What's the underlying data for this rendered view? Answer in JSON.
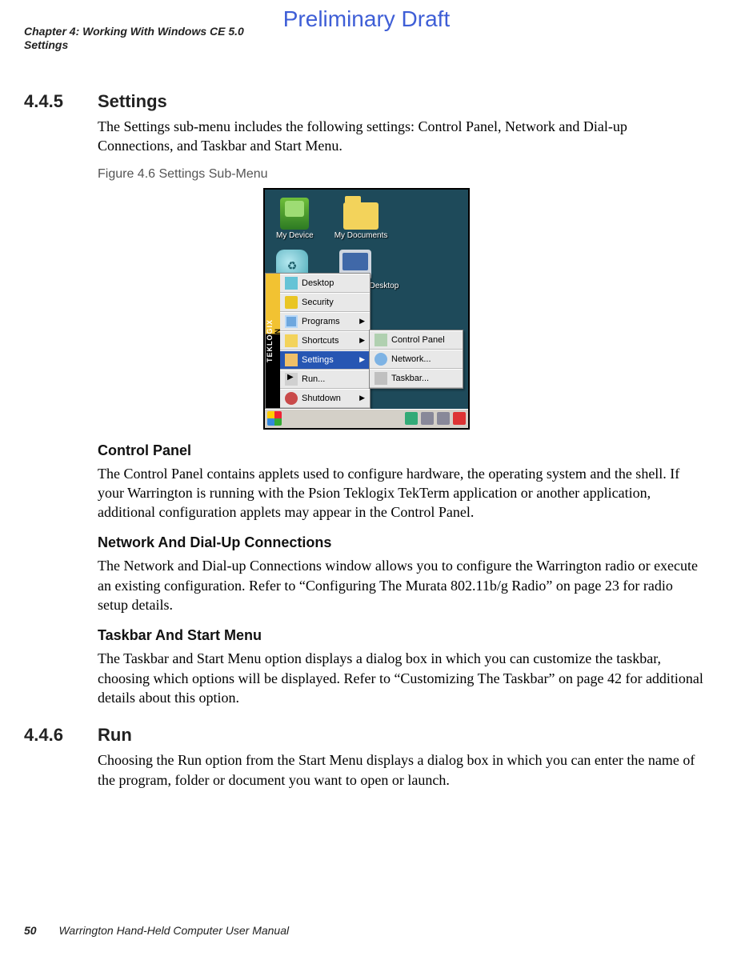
{
  "watermark": "Preliminary Draft",
  "header": {
    "chapter": "Chapter 4:  Working With Windows CE 5.0",
    "section": "Settings"
  },
  "sections": {
    "s445": {
      "num": "4.4.5",
      "title": "Settings",
      "intro": "The Settings sub-menu includes the following settings: Control Panel, Network and Dial-up Connections, and Taskbar and Start Menu.",
      "figure_caption": "Figure 4.6  Settings Sub-Menu"
    },
    "s446": {
      "num": "4.4.6",
      "title": "Run",
      "body": "Choosing the Run option from the Start Menu displays a dialog box in which you can enter the name of the program, folder or document you want to open or launch."
    }
  },
  "screenshot": {
    "brandbar": {
      "line1": "TEKLOGIX",
      "line2": "PSION"
    },
    "desktop_icons": [
      {
        "name": "My Device"
      },
      {
        "name": "My Documents"
      },
      {
        "name": "Recycle Bin"
      },
      {
        "name": "Remote Desktop"
      }
    ],
    "start_menu": [
      {
        "label": "Desktop",
        "selected": false,
        "has_submenu": false
      },
      {
        "label": "Security",
        "selected": false,
        "has_submenu": false
      },
      {
        "label": "Programs",
        "selected": false,
        "has_submenu": true
      },
      {
        "label": "Shortcuts",
        "selected": false,
        "has_submenu": true
      },
      {
        "label": "Settings",
        "selected": true,
        "has_submenu": true
      },
      {
        "label": "Run...",
        "selected": false,
        "has_submenu": false
      },
      {
        "label": "Shutdown",
        "selected": false,
        "has_submenu": true
      }
    ],
    "settings_submenu": [
      {
        "label": "Control Panel"
      },
      {
        "label": "Network..."
      },
      {
        "label": "Taskbar..."
      }
    ]
  },
  "subsections": {
    "control_panel": {
      "heading": "Control Panel",
      "body": "The Control Panel contains applets used to configure hardware, the operating system and the shell. If your Warrington is running with the Psion Teklogix TekTerm application or another application, additional configuration applets may appear in the Control Panel."
    },
    "network": {
      "heading": "Network And Dial-Up Connections",
      "body": "The Network and Dial-up Connections window allows you to configure the Warrington radio or execute an existing configuration. Refer to “Configuring The Murata 802.11b/g Radio” on page 23 for radio setup details."
    },
    "taskbar": {
      "heading": "Taskbar And Start Menu",
      "body": "The Taskbar and Start Menu option displays a dialog box in which you can customize the taskbar, choosing which options will be displayed. Refer to “Customizing The Taskbar” on page 42 for additional details about this option."
    }
  },
  "footer": {
    "page_number": "50",
    "book_title": "Warrington Hand-Held Computer User Manual"
  }
}
